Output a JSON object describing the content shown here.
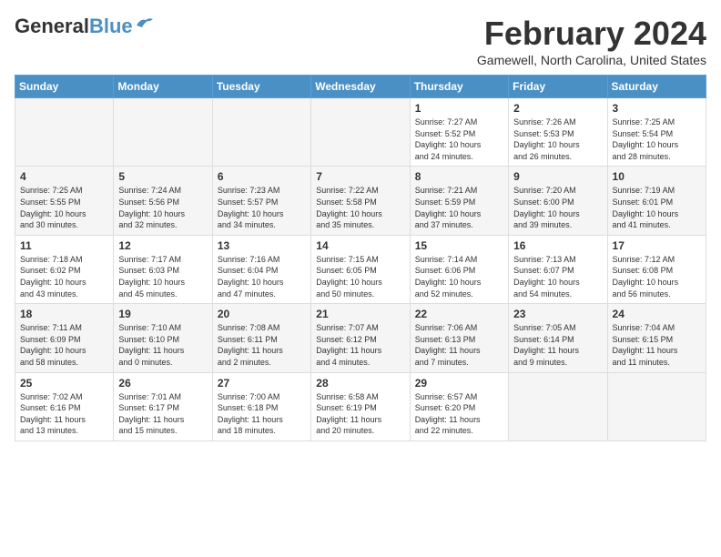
{
  "header": {
    "logo_general": "General",
    "logo_blue": "Blue",
    "month": "February 2024",
    "location": "Gamewell, North Carolina, United States"
  },
  "weekdays": [
    "Sunday",
    "Monday",
    "Tuesday",
    "Wednesday",
    "Thursday",
    "Friday",
    "Saturday"
  ],
  "weeks": [
    [
      {
        "day": "",
        "info": ""
      },
      {
        "day": "",
        "info": ""
      },
      {
        "day": "",
        "info": ""
      },
      {
        "day": "",
        "info": ""
      },
      {
        "day": "1",
        "info": "Sunrise: 7:27 AM\nSunset: 5:52 PM\nDaylight: 10 hours\nand 24 minutes."
      },
      {
        "day": "2",
        "info": "Sunrise: 7:26 AM\nSunset: 5:53 PM\nDaylight: 10 hours\nand 26 minutes."
      },
      {
        "day": "3",
        "info": "Sunrise: 7:25 AM\nSunset: 5:54 PM\nDaylight: 10 hours\nand 28 minutes."
      }
    ],
    [
      {
        "day": "4",
        "info": "Sunrise: 7:25 AM\nSunset: 5:55 PM\nDaylight: 10 hours\nand 30 minutes."
      },
      {
        "day": "5",
        "info": "Sunrise: 7:24 AM\nSunset: 5:56 PM\nDaylight: 10 hours\nand 32 minutes."
      },
      {
        "day": "6",
        "info": "Sunrise: 7:23 AM\nSunset: 5:57 PM\nDaylight: 10 hours\nand 34 minutes."
      },
      {
        "day": "7",
        "info": "Sunrise: 7:22 AM\nSunset: 5:58 PM\nDaylight: 10 hours\nand 35 minutes."
      },
      {
        "day": "8",
        "info": "Sunrise: 7:21 AM\nSunset: 5:59 PM\nDaylight: 10 hours\nand 37 minutes."
      },
      {
        "day": "9",
        "info": "Sunrise: 7:20 AM\nSunset: 6:00 PM\nDaylight: 10 hours\nand 39 minutes."
      },
      {
        "day": "10",
        "info": "Sunrise: 7:19 AM\nSunset: 6:01 PM\nDaylight: 10 hours\nand 41 minutes."
      }
    ],
    [
      {
        "day": "11",
        "info": "Sunrise: 7:18 AM\nSunset: 6:02 PM\nDaylight: 10 hours\nand 43 minutes."
      },
      {
        "day": "12",
        "info": "Sunrise: 7:17 AM\nSunset: 6:03 PM\nDaylight: 10 hours\nand 45 minutes."
      },
      {
        "day": "13",
        "info": "Sunrise: 7:16 AM\nSunset: 6:04 PM\nDaylight: 10 hours\nand 47 minutes."
      },
      {
        "day": "14",
        "info": "Sunrise: 7:15 AM\nSunset: 6:05 PM\nDaylight: 10 hours\nand 50 minutes."
      },
      {
        "day": "15",
        "info": "Sunrise: 7:14 AM\nSunset: 6:06 PM\nDaylight: 10 hours\nand 52 minutes."
      },
      {
        "day": "16",
        "info": "Sunrise: 7:13 AM\nSunset: 6:07 PM\nDaylight: 10 hours\nand 54 minutes."
      },
      {
        "day": "17",
        "info": "Sunrise: 7:12 AM\nSunset: 6:08 PM\nDaylight: 10 hours\nand 56 minutes."
      }
    ],
    [
      {
        "day": "18",
        "info": "Sunrise: 7:11 AM\nSunset: 6:09 PM\nDaylight: 10 hours\nand 58 minutes."
      },
      {
        "day": "19",
        "info": "Sunrise: 7:10 AM\nSunset: 6:10 PM\nDaylight: 11 hours\nand 0 minutes."
      },
      {
        "day": "20",
        "info": "Sunrise: 7:08 AM\nSunset: 6:11 PM\nDaylight: 11 hours\nand 2 minutes."
      },
      {
        "day": "21",
        "info": "Sunrise: 7:07 AM\nSunset: 6:12 PM\nDaylight: 11 hours\nand 4 minutes."
      },
      {
        "day": "22",
        "info": "Sunrise: 7:06 AM\nSunset: 6:13 PM\nDaylight: 11 hours\nand 7 minutes."
      },
      {
        "day": "23",
        "info": "Sunrise: 7:05 AM\nSunset: 6:14 PM\nDaylight: 11 hours\nand 9 minutes."
      },
      {
        "day": "24",
        "info": "Sunrise: 7:04 AM\nSunset: 6:15 PM\nDaylight: 11 hours\nand 11 minutes."
      }
    ],
    [
      {
        "day": "25",
        "info": "Sunrise: 7:02 AM\nSunset: 6:16 PM\nDaylight: 11 hours\nand 13 minutes."
      },
      {
        "day": "26",
        "info": "Sunrise: 7:01 AM\nSunset: 6:17 PM\nDaylight: 11 hours\nand 15 minutes."
      },
      {
        "day": "27",
        "info": "Sunrise: 7:00 AM\nSunset: 6:18 PM\nDaylight: 11 hours\nand 18 minutes."
      },
      {
        "day": "28",
        "info": "Sunrise: 6:58 AM\nSunset: 6:19 PM\nDaylight: 11 hours\nand 20 minutes."
      },
      {
        "day": "29",
        "info": "Sunrise: 6:57 AM\nSunset: 6:20 PM\nDaylight: 11 hours\nand 22 minutes."
      },
      {
        "day": "",
        "info": ""
      },
      {
        "day": "",
        "info": ""
      }
    ]
  ]
}
